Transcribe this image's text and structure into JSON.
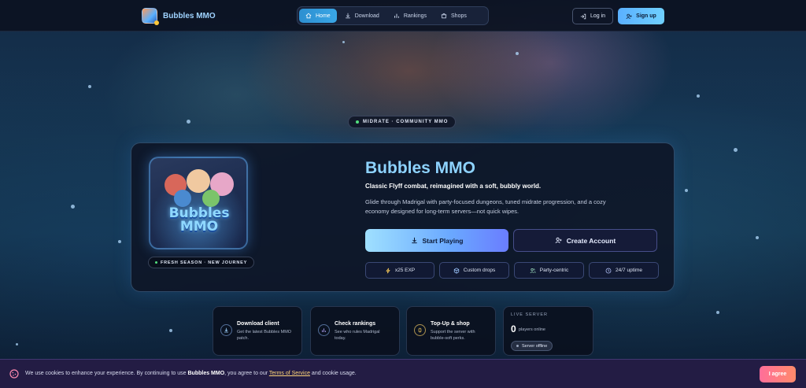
{
  "brand": {
    "name": "Bubbles MMO"
  },
  "nav": {
    "items": [
      {
        "label": "Home",
        "icon": "home-icon",
        "active": true
      },
      {
        "label": "Download",
        "icon": "download-icon",
        "active": false
      },
      {
        "label": "Rankings",
        "icon": "bar-chart-icon",
        "active": false
      },
      {
        "label": "Shops",
        "icon": "shop-icon",
        "active": false
      }
    ],
    "login_label": "Log in",
    "signup_label": "Sign up"
  },
  "hero": {
    "tag": "MIDRATE · COMMUNITY MMO",
    "game_art_text": "Bubbles MMO",
    "season_badge": "FRESH SEASON · NEW JOURNEY",
    "title": "Bubbles MMO",
    "subtitle": "Classic Flyff combat, reimagined with a soft, bubbly world.",
    "description": "Glide through Madrigal with party-focused dungeons, tuned midrate progression, and a cozy economy designed for long-term servers—not quick wipes.",
    "play_label": "Start Playing",
    "create_label": "Create Account",
    "features": [
      {
        "label": "x25 EXP",
        "icon": "bolt-icon"
      },
      {
        "label": "Custom drops",
        "icon": "cube-icon"
      },
      {
        "label": "Party-centric",
        "icon": "users-icon"
      },
      {
        "label": "24/7 uptime",
        "icon": "clock-icon"
      }
    ]
  },
  "cards": [
    {
      "title": "Download client",
      "desc": "Get the latest Bubbles MMO patch.",
      "icon": "download-icon"
    },
    {
      "title": "Check rankings",
      "desc": "See who rules Madrigal today.",
      "icon": "bar-chart-icon"
    },
    {
      "title": "Top-Up & shop",
      "desc": "Support the server with bubble-soft perks.",
      "icon": "coin-icon"
    }
  ],
  "live_server": {
    "label": "LIVE SERVER",
    "count": "0",
    "count_label": "players online",
    "status": "Server offline"
  },
  "cookie": {
    "text_before": "We use cookies to enhance your experience. By continuing to use ",
    "brand": "Bubbles MMO",
    "text_middle": ", you agree to our ",
    "link": "Terms of Service",
    "text_after": " and cookie usage.",
    "agree_label": "I agree"
  },
  "colors": {
    "accent": "#8ed3ff",
    "cta_start": "#9fe0ff",
    "cta_end": "#6a7dff",
    "agree": "#ff6e9a",
    "online_dot": "#52e07e"
  }
}
